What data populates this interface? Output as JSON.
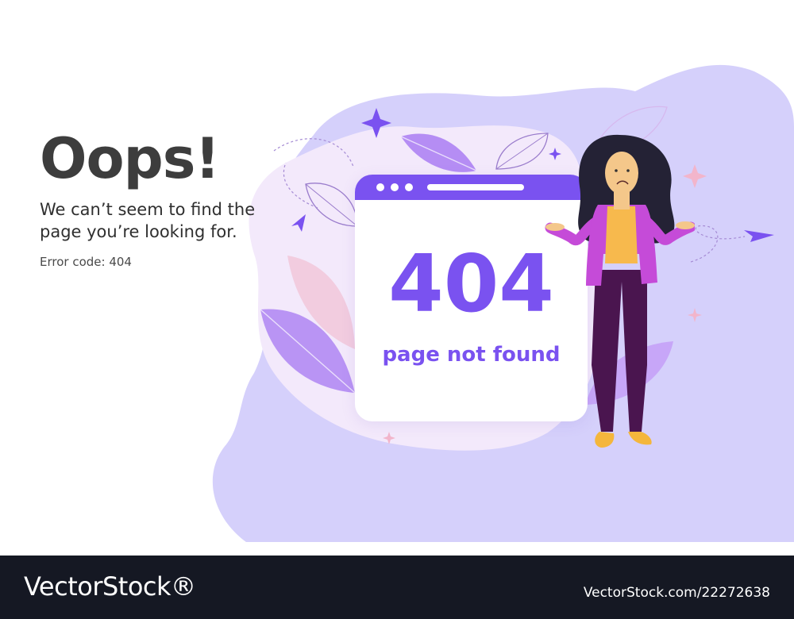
{
  "headline": "Oops!",
  "message": {
    "line1": "We can’t seem to find the",
    "line2": "page you’re looking for."
  },
  "error_code": "Error code: 404",
  "browser_window": {
    "number": "404",
    "label": "page not found"
  },
  "footer": {
    "brand": "VectorStock®",
    "image_id": "VectorStock.com/22272638"
  },
  "colors": {
    "accent": "#7a52f0",
    "headline": "#3d3d3d",
    "blob_light": "#efe5fb",
    "blob_dark": "#d3cdfb",
    "footer": "#151823"
  },
  "icons": [
    "sparkle-icon",
    "paper-plane-icon",
    "leaf-icon"
  ]
}
